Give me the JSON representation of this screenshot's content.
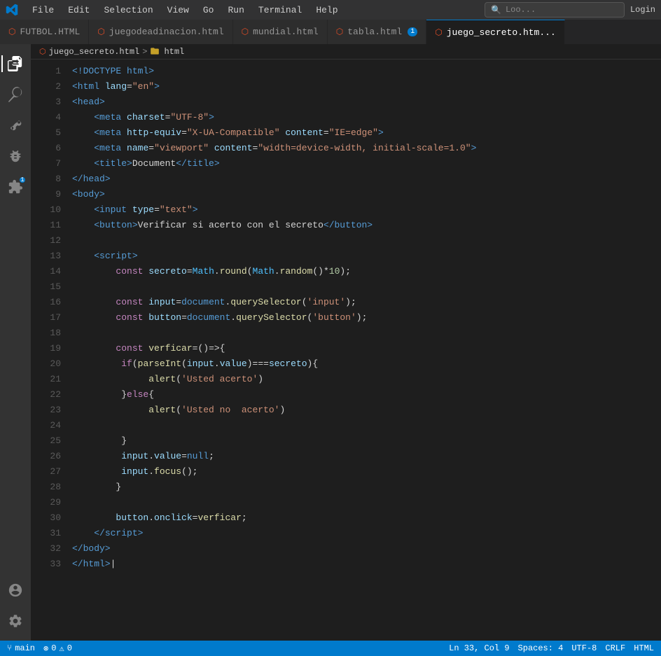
{
  "titlebar": {
    "menu": [
      "File",
      "Edit",
      "Selection",
      "View",
      "Go",
      "Run",
      "Terminal",
      "Help"
    ],
    "search_placeholder": "Loo...",
    "login_label": "Login"
  },
  "tabs": [
    {
      "id": "futbol",
      "label": "FUTBOL.HTML",
      "icon": "html",
      "active": false,
      "badge": null
    },
    {
      "id": "juego",
      "label": "juegodeadinacion.html",
      "icon": "html",
      "active": false,
      "badge": null
    },
    {
      "id": "mundial",
      "label": "mundial.html",
      "icon": "html",
      "active": false,
      "badge": null
    },
    {
      "id": "tabla",
      "label": "tabla.html",
      "icon": "html",
      "active": false,
      "badge": "1"
    },
    {
      "id": "juego_secreto",
      "label": "juego_secreto.htm...",
      "icon": "html",
      "active": true,
      "badge": null
    }
  ],
  "breadcrumb": {
    "file": "juego_secreto.html",
    "separator": ">",
    "folder": "html"
  },
  "activity": {
    "icons": [
      "explorer",
      "search",
      "source-control",
      "debug",
      "extensions",
      "account",
      "settings"
    ]
  },
  "code": {
    "lines": [
      {
        "num": 1,
        "html": "<span class='dt'>&lt;!DOCTYPE html&gt;</span>"
      },
      {
        "num": 2,
        "html": "<span class='tg'>&lt;html</span> <span class='at'>lang</span><span class='op'>=</span><span class='vl'>\"en\"</span><span class='tg'>&gt;</span>"
      },
      {
        "num": 3,
        "html": "<span class='tg'>&lt;head&gt;</span>"
      },
      {
        "num": 4,
        "html": "    <span class='tg'>&lt;meta</span> <span class='at'>charset</span><span class='op'>=</span><span class='vl'>\"UTF-8\"</span><span class='tg'>&gt;</span>"
      },
      {
        "num": 5,
        "html": "    <span class='tg'>&lt;meta</span> <span class='at'>http-equiv</span><span class='op'>=</span><span class='vl'>\"X-UA-Compatible\"</span> <span class='at'>content</span><span class='op'>=</span><span class='vl'>\"IE=edge\"</span><span class='tg'>&gt;</span>"
      },
      {
        "num": 6,
        "html": "    <span class='tg'>&lt;meta</span> <span class='at'>name</span><span class='op'>=</span><span class='vl'>\"viewport\"</span> <span class='at'>content</span><span class='op'>=</span><span class='vl'>\"width=device-width, initial-scale=1.0\"</span><span class='tg'>&gt;</span>"
      },
      {
        "num": 7,
        "html": "    <span class='tg'>&lt;title&gt;</span><span class='tx'>Document</span><span class='tg'>&lt;/title&gt;</span>"
      },
      {
        "num": 8,
        "html": "<span class='tg'>&lt;/head&gt;</span>"
      },
      {
        "num": 9,
        "html": "<span class='tg'>&lt;body&gt;</span>"
      },
      {
        "num": 10,
        "html": "    <span class='tg'>&lt;input</span> <span class='at'>type</span><span class='op'>=</span><span class='vl'>\"text\"</span><span class='tg'>&gt;</span>"
      },
      {
        "num": 11,
        "html": "    <span class='tg'>&lt;button&gt;</span><span class='tx'>Verificar si acerto con el secreto</span><span class='tg'>&lt;/button&gt;</span>"
      },
      {
        "num": 12,
        "html": ""
      },
      {
        "num": 13,
        "html": "    <span class='tg'>&lt;script&gt;</span>"
      },
      {
        "num": 14,
        "html": "        <span class='kw'>const</span> <span class='pr'>secreto</span><span class='op'>=</span><span class='mx'>Math</span><span class='op'>.</span><span class='fn'>round</span><span class='op'>(</span><span class='mx'>Math</span><span class='op'>.</span><span class='fn'>random</span><span class='op'>()*</span><span class='nm'>10</span><span class='op'>);</span>"
      },
      {
        "num": 15,
        "html": ""
      },
      {
        "num": 16,
        "html": "        <span class='kw'>const</span> <span class='pr'>input</span><span class='op'>=</span><span class='bl'>document</span><span class='op'>.</span><span class='fn'>querySelector</span><span class='op'>(</span><span class='st'>'input'</span><span class='op'>);</span>"
      },
      {
        "num": 17,
        "html": "        <span class='kw'>const</span> <span class='pr'>button</span><span class='op'>=</span><span class='bl'>document</span><span class='op'>.</span><span class='fn'>querySelector</span><span class='op'>(</span><span class='st'>'button'</span><span class='op'>);</span>"
      },
      {
        "num": 18,
        "html": ""
      },
      {
        "num": 19,
        "html": "        <span class='kw'>const</span> <span class='fn'>verficar</span><span class='op'>=()=&gt;{</span>"
      },
      {
        "num": 20,
        "html": "         <span class='kw'>if</span><span class='op'>(</span><span class='fn'>parseInt</span><span class='op'>(</span><span class='pr'>input</span><span class='op'>.</span><span class='pr'>value</span><span class='op'>)===</span><span class='pr'>secreto</span><span class='op'>){</span>"
      },
      {
        "num": 21,
        "html": "              <span class='fn'>alert</span><span class='op'>(</span><span class='st'>'Usted acerto'</span><span class='op'>)</span>"
      },
      {
        "num": 22,
        "html": "         <span class='op'>}</span><span class='kw'>else</span><span class='op'>{</span>"
      },
      {
        "num": 23,
        "html": "              <span class='fn'>alert</span><span class='op'>(</span><span class='st'>'Usted no  acerto'</span><span class='op'>)</span>"
      },
      {
        "num": 24,
        "html": ""
      },
      {
        "num": 25,
        "html": "         <span class='op'>}</span>"
      },
      {
        "num": 26,
        "html": "         <span class='pr'>input</span><span class='op'>.</span><span class='pr'>value</span><span class='op'>=</span><span class='bl'>null</span><span class='op'>;</span>"
      },
      {
        "num": 27,
        "html": "         <span class='pr'>input</span><span class='op'>.</span><span class='fn'>focus</span><span class='op'>();</span>"
      },
      {
        "num": 28,
        "html": "        <span class='op'>}</span>"
      },
      {
        "num": 29,
        "html": ""
      },
      {
        "num": 30,
        "html": "        <span class='pr'>button</span><span class='op'>.</span><span class='pr'>onclick</span><span class='op'>=</span><span class='fn'>verficar</span><span class='op'>;</span>"
      },
      {
        "num": 31,
        "html": "    <span class='tg'>&lt;/script&gt;</span>"
      },
      {
        "num": 32,
        "html": "<span class='tg'>&lt;/body&gt;</span>"
      },
      {
        "num": 33,
        "html": "<span class='tg'>&lt;/html&gt;</span><span class='tx'>|</span>"
      }
    ]
  },
  "statusbar": {
    "branch": "main",
    "errors": "0",
    "warnings": "0",
    "line": "Ln 33, Col 9",
    "spaces": "Spaces: 4",
    "encoding": "UTF-8",
    "eol": "CRLF",
    "language": "HTML"
  }
}
